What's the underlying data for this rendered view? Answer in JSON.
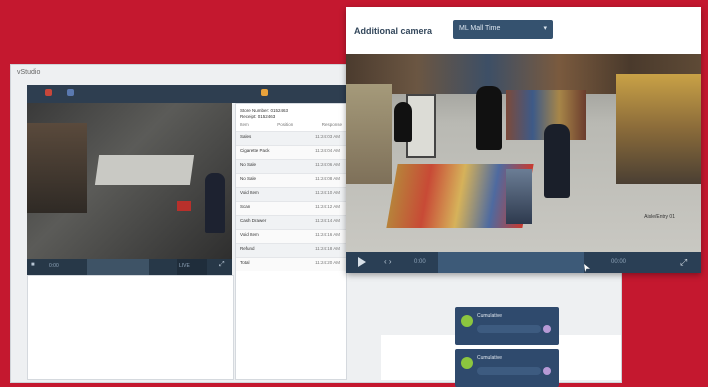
{
  "back_window": {
    "title": "vStudio",
    "panel": {
      "header_line1": "Store Number: 0152463",
      "header_line2": "Receipt: 0152463",
      "col_item": "Item",
      "col_position": "Position",
      "col_response": "Response",
      "rows": [
        {
          "label": "Sales",
          "time": "11:24:03 AM"
        },
        {
          "label": "Cigarette Pack",
          "time": "11:24:04 AM"
        },
        {
          "label": "No Sale",
          "time": "11:24:06 AM"
        },
        {
          "label": "No Sale",
          "time": "11:24:08 AM"
        },
        {
          "label": "Void Item",
          "time": "11:24:10 AM"
        },
        {
          "label": "Scan",
          "time": "11:24:12 AM"
        },
        {
          "label": "Cash Drawer",
          "time": "11:24:14 AM"
        },
        {
          "label": "Void Item",
          "time": "11:24:16 AM"
        },
        {
          "label": "Refund",
          "time": "11:24:18 AM"
        },
        {
          "label": "Total",
          "time": "11:24:20 AM"
        }
      ]
    },
    "video_controls": {
      "time": "0:00",
      "live": "LIVE"
    }
  },
  "front_window": {
    "title": "Additional camera",
    "dropdown_value": "ML Mall Time",
    "video_timestamp": "Aisle/Entry 01",
    "controls": {
      "time": "0:00",
      "timer": "00:00"
    }
  },
  "alerts": [
    {
      "label": "Cumulative"
    },
    {
      "label": "Cumulative"
    }
  ],
  "colors": {
    "background": "#c4182f",
    "nav_dark": "#2e3e50",
    "accent_green": "#8cc63f"
  }
}
